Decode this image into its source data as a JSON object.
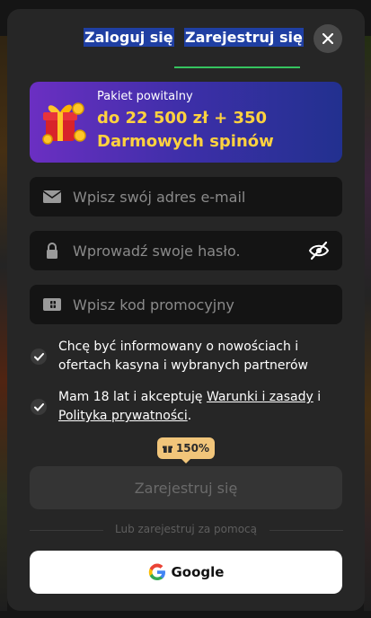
{
  "tabs": {
    "login": "Zaloguj się",
    "register": "Zarejestruj się",
    "active": "register"
  },
  "close_icon": "close-icon",
  "promo": {
    "small": "Pakiet powitalny",
    "big_line1": "do 22 500 zł + 350",
    "big_line2": "Darmowych spinów",
    "icon": "gift-icon"
  },
  "form": {
    "email_placeholder": "Wpisz swój adres e-mail",
    "password_placeholder": "Wprowadź swoje hasło.",
    "promo_placeholder": "Wpisz kod promocyjny"
  },
  "consents": {
    "marketing": "Chcę być informowany o nowościach i ofertach kasyna i wybranych partnerów",
    "age_prefix": "Mam 18 lat i akceptuję ",
    "terms_link": "Warunki i zasady",
    "age_and": " i",
    "privacy_link": "Polityka prywatności",
    "age_suffix": "."
  },
  "bonus_badge": "150%",
  "register_button": "Zarejestruj się",
  "divider_text": "Lub zarejestruj za pomocą",
  "google_button": "Google",
  "colors": {
    "accent_green": "#35c35f",
    "promo_yellow": "#ffd23f",
    "badge_gold": "#f1c57a",
    "modal_bg": "#262626"
  }
}
